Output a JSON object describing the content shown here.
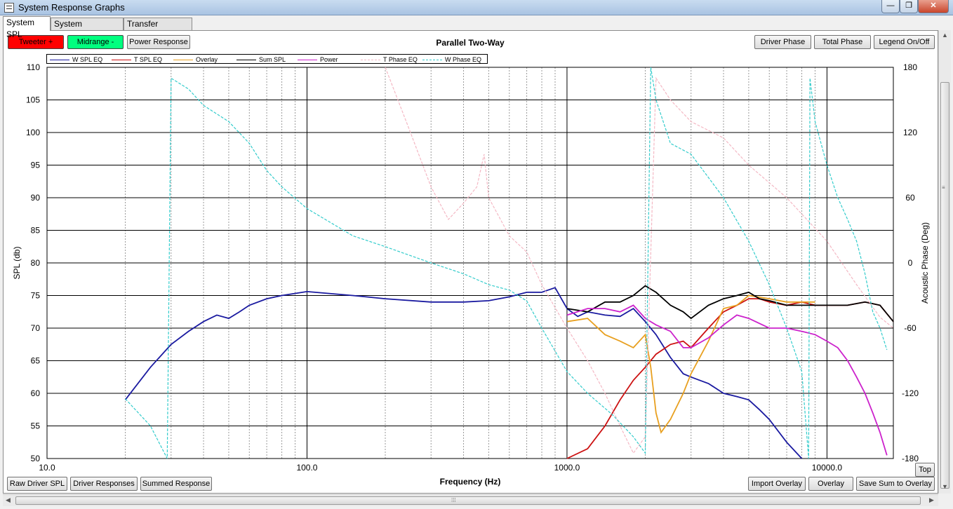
{
  "window": {
    "title": "System Response Graphs",
    "minimize_glyph": "—",
    "maximize_glyph": "❐",
    "close_glyph": "✕"
  },
  "tabs": [
    {
      "label": "System SPL",
      "active": true
    },
    {
      "label": "System Impedance",
      "active": false
    },
    {
      "label": "Transfer Functions",
      "active": false
    }
  ],
  "toolbar": {
    "tweeter_label": "Tweeter +",
    "tweeter_color": "#ff0000",
    "midrange_label": "Midrange -",
    "midrange_color": "#00ff7f",
    "power_response_label": "Power Response",
    "driver_phase_label": "Driver Phase",
    "total_phase_label": "Total Phase",
    "legend_toggle_label": "Legend On/Off"
  },
  "bottom_bar": {
    "raw_driver_spl_label": "Raw Driver SPL",
    "driver_responses_label": "Driver Responses",
    "summed_response_label": "Summed Response",
    "import_overlay_label": "Import Overlay",
    "overlay_label": "Overlay",
    "save_sum_label": "Save Sum to Overlay",
    "top_label": "Top"
  },
  "scroll": {
    "grip_glyph": "⁞⁞⁞"
  },
  "chart_data": {
    "type": "line",
    "title": "Parallel Two-Way",
    "xlabel": "Frequency (Hz)",
    "ylabel": "SPL (db)",
    "y2label": "Acoustic Phase (Deg)",
    "x_scale": "log",
    "xlim": [
      10,
      18000
    ],
    "ylim": [
      50,
      110
    ],
    "y2lim": [
      -180,
      180
    ],
    "x_tick_labels": [
      "10.0",
      "100.0",
      "1000.0",
      "10000.0"
    ],
    "y_tick_labels": [
      "50",
      "55",
      "60",
      "65",
      "70",
      "75",
      "80",
      "85",
      "90",
      "95",
      "100",
      "105",
      "110"
    ],
    "y2_tick_labels": [
      "-180",
      "-120",
      "-60",
      "0",
      "60",
      "120",
      "180"
    ],
    "grid": true,
    "legend_position": "top",
    "series": [
      {
        "name": "W SPL EQ",
        "color": "#1a1aa0",
        "axis": "left",
        "dash": false,
        "x": [
          20,
          25,
          30,
          35,
          40,
          45,
          50,
          55,
          60,
          70,
          80,
          100,
          150,
          200,
          300,
          400,
          500,
          600,
          700,
          800,
          900,
          1000,
          1100,
          1200,
          1400,
          1600,
          1800,
          2000,
          2200,
          2500,
          2800,
          3000,
          3500,
          4000,
          4500,
          5000,
          5500,
          6000,
          7000,
          8000
        ],
        "y": [
          59,
          64,
          67.5,
          69.5,
          71,
          72,
          71.5,
          72.5,
          73.5,
          74.5,
          75,
          75.6,
          75,
          74.5,
          74,
          74,
          74.2,
          74.8,
          75.5,
          75.5,
          76.2,
          73,
          71.8,
          72.5,
          72,
          71.8,
          73,
          71,
          69,
          65.5,
          63,
          62.5,
          61.5,
          60,
          59.5,
          59,
          57.5,
          56,
          52.5,
          50
        ]
      },
      {
        "name": "T SPL EQ",
        "color": "#cc1111",
        "axis": "left",
        "dash": false,
        "x": [
          1000,
          1200,
          1400,
          1600,
          1800,
          2000,
          2200,
          2500,
          2800,
          3000,
          3500,
          4000,
          4500,
          5000,
          5500,
          6000,
          7000,
          8000,
          9000,
          10000,
          12000,
          14000,
          16000,
          18000
        ],
        "y": [
          50,
          51.5,
          55,
          59,
          62,
          64,
          66,
          67.5,
          68,
          67,
          70,
          72.5,
          73.5,
          74.5,
          74.5,
          74,
          73.5,
          74,
          73.5,
          73.5,
          73.5,
          74,
          73.5,
          71
        ]
      },
      {
        "name": "Overlay",
        "color": "#e8a020",
        "axis": "left",
        "dash": false,
        "x": [
          1000,
          1200,
          1400,
          1600,
          1800,
          2000,
          2100,
          2200,
          2300,
          2500,
          2800,
          3000,
          3500,
          4000,
          4500,
          5000,
          6000,
          7000,
          8000,
          9000
        ],
        "y": [
          71,
          71.5,
          69,
          68,
          67,
          69,
          64,
          57,
          54,
          56,
          60,
          63,
          68,
          73,
          73.5,
          75,
          74.5,
          74,
          74,
          74
        ]
      },
      {
        "name": "Sum SPL",
        "color": "#000000",
        "axis": "left",
        "dash": false,
        "x": [
          1000,
          1200,
          1400,
          1600,
          1800,
          2000,
          2200,
          2500,
          2800,
          3000,
          3500,
          4000,
          4500,
          5000,
          5500,
          6000,
          7000,
          8000,
          9000,
          10000,
          12000,
          14000,
          16000,
          18000
        ],
        "y": [
          73,
          72.5,
          74,
          74,
          75,
          76.5,
          75.5,
          73.5,
          72.5,
          71.5,
          73.5,
          74.5,
          75,
          75.5,
          74.5,
          74.2,
          73.5,
          73.5,
          73.5,
          73.5,
          73.5,
          74,
          73.5,
          71
        ]
      },
      {
        "name": "Power",
        "color": "#cc22cc",
        "axis": "left",
        "dash": false,
        "x": [
          1000,
          1200,
          1400,
          1600,
          1800,
          2000,
          2200,
          2500,
          2800,
          3000,
          3500,
          4000,
          4500,
          5000,
          6000,
          7000,
          8000,
          9000,
          10000,
          11000,
          12000,
          13000,
          14000,
          15000,
          16000,
          17000
        ],
        "y": [
          72,
          73,
          73,
          72.5,
          73.5,
          71.5,
          70.5,
          69.5,
          67,
          67,
          68.5,
          70.5,
          72,
          71.5,
          70,
          70,
          69.5,
          69,
          68,
          67,
          65,
          62.5,
          60,
          57,
          54,
          50.5
        ]
      },
      {
        "name": "T Phase EQ",
        "color": "#f4b8c4",
        "axis": "right",
        "dash": true,
        "x": [
          200,
          250,
          300,
          350,
          400,
          450,
          480,
          500,
          600,
          700,
          800,
          1000,
          1200,
          1400,
          1600,
          1800,
          2000,
          2200,
          2500,
          3000,
          4000,
          5000,
          7000,
          10000,
          13000,
          16000,
          18000
        ],
        "y": [
          180,
          120,
          70,
          40,
          55,
          70,
          100,
          60,
          25,
          10,
          -20,
          -60,
          -90,
          -120,
          -150,
          -175,
          -160,
          170,
          150,
          130,
          115,
          90,
          60,
          20,
          -20,
          -50,
          -60
        ]
      },
      {
        "name": "W Phase EQ",
        "color": "#33cccc",
        "axis": "right",
        "dash": true,
        "x": [
          20,
          25,
          29,
          30,
          35,
          40,
          50,
          60,
          70,
          80,
          100,
          150,
          200,
          300,
          400,
          500,
          600,
          700,
          800,
          1000,
          1200,
          1500,
          1800,
          2000,
          2100,
          2150,
          2200,
          2500,
          3000,
          4000,
          5000,
          6000,
          7000,
          8000,
          8500,
          8600,
          9000,
          10000,
          11000,
          12000,
          13000,
          14000,
          15000,
          16000,
          17000
        ],
        "y": [
          -125,
          -150,
          -180,
          170,
          160,
          145,
          130,
          110,
          85,
          70,
          50,
          25,
          15,
          0,
          -10,
          -20,
          -25,
          -35,
          -60,
          -100,
          -120,
          -140,
          -160,
          -175,
          180,
          165,
          150,
          110,
          100,
          60,
          20,
          -20,
          -60,
          -100,
          -180,
          170,
          130,
          90,
          60,
          40,
          20,
          -10,
          -45,
          -60,
          -80
        ]
      }
    ]
  }
}
